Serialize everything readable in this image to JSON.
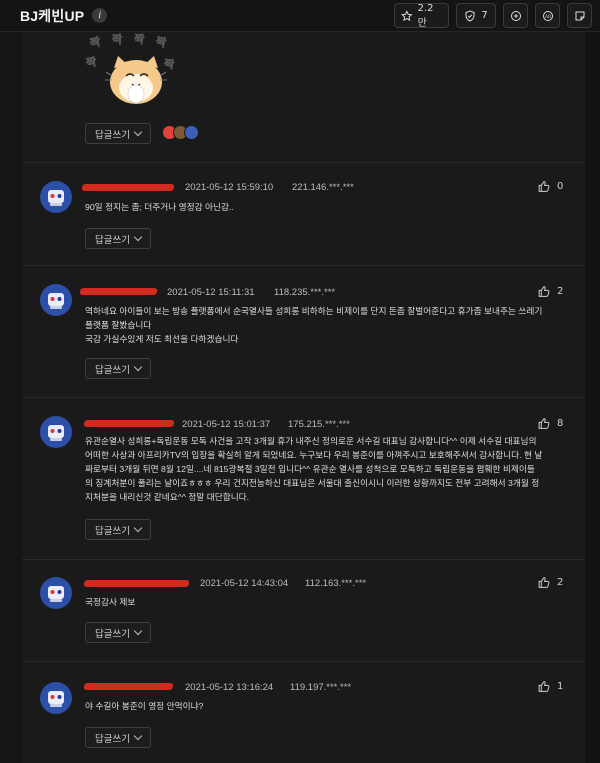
{
  "header": {
    "title": "BJ케빈UP",
    "info_glyph": "i",
    "stats": [
      {
        "icon": "star-icon",
        "value": "2.2만"
      },
      {
        "icon": "shield-badge-icon",
        "value": "7"
      }
    ]
  },
  "top_reply_button": "답글쓰기",
  "colors": {
    "background": "#151515",
    "panel": "#1a1a1a",
    "redaction": "#d12a1e",
    "avatar": "#2c4fa8"
  },
  "comments": [
    {
      "date": "2021-05-12 15:59:10",
      "ip": "221.146.***.***",
      "likes": "0",
      "text": "90일 정지는 좀; 더주거나 영정감 아닌감..",
      "reply": "답글쓰기"
    },
    {
      "date": "2021-05-12 15:11:31",
      "ip": "118.235.***.***",
      "likes": "2",
      "text": "역하네요 아이들이 보는 방송 플랫폼에서 순국열사들 성희롱 비하하는 비제이를 단지 돈좀 잘벌어준다고 휴가좀 보내주는 쓰레기\n플랫폼 잘봤습니다\n국감 가실수있게 저도 최선을 다하겠습니다",
      "reply": "답글쓰기"
    },
    {
      "date": "2021-05-12 15:01:37",
      "ip": "175.215.***.***",
      "likes": "8",
      "text": "유관순열사 성희롱+독립운동 모독 사건을 고작 3개월 휴가 내주신 정의로운 서수길 대표님 감사합니다^^ 이제 서수길 대표님의\n어떠한 사상과 아프리카TV의 입장을 확실히 알게 되었네요. 누구보다 우리 봉준이를 아껴주시고 보호해주셔서 감사합니다. 현 날\n짜로부터 3개월 뒤면 8월 12일....네 815광복절 3일전 입니다^^ 유관순 열사를 성척으로 모독하고 독립운동을 폄훼한 비제이들\n의 징계처분이 풀리는 날이죠ㅎㅎㅎ 우리 건지전능하신 대표님은 서울대 출신이시니 이러한 상황까지도 전부 고려해서 3개월 정\n지처분을 내리신것 같네요^^ 정말 대단합니다.",
      "reply": "답글쓰기"
    },
    {
      "date": "2021-05-12 14:43:04",
      "ip": "112.163.***.***",
      "likes": "2",
      "text": "국정감사 제보",
      "reply": "답글쓰기"
    },
    {
      "date": "2021-05-12 13:16:24",
      "ip": "119.197.***.***",
      "likes": "1",
      "text": "야 수길아 봉준이 영정 안먹이냐?",
      "reply": "답글쓰기"
    }
  ]
}
